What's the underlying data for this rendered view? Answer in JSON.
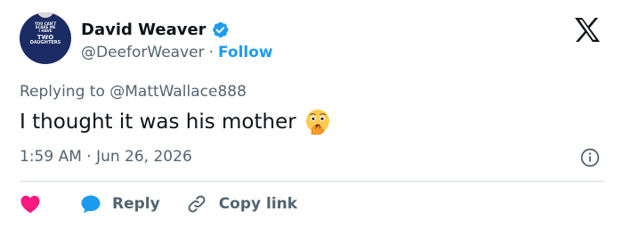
{
  "author": {
    "display_name": "David Weaver",
    "handle": "@DeeforWeaver",
    "separator": "·",
    "follow_label": "Follow",
    "avatar_text": [
      "YOU CAN'T SCARE ME",
      "I HAVE",
      "TWO",
      "DAUGHTERS"
    ]
  },
  "icons": {
    "verified": "verified-badge-icon",
    "platform": "x-logo-icon",
    "emoji": "face-with-open-eyes-and-hand-over-mouth",
    "info": "info-icon",
    "like": "heart-icon",
    "reply": "reply-bubble-icon",
    "copy": "link-icon"
  },
  "colors": {
    "accent": "#1d9bf0",
    "like": "#f91880",
    "muted": "#536471",
    "text": "#0f1419"
  },
  "tweet": {
    "replying_prefix": "Replying to",
    "replying_to": "@MattWallace888",
    "text": "I thought it was his mother",
    "timestamp": "1:59 AM · Jun 26, 2026"
  },
  "actions": {
    "reply_label": "Reply",
    "copy_label": "Copy link"
  }
}
